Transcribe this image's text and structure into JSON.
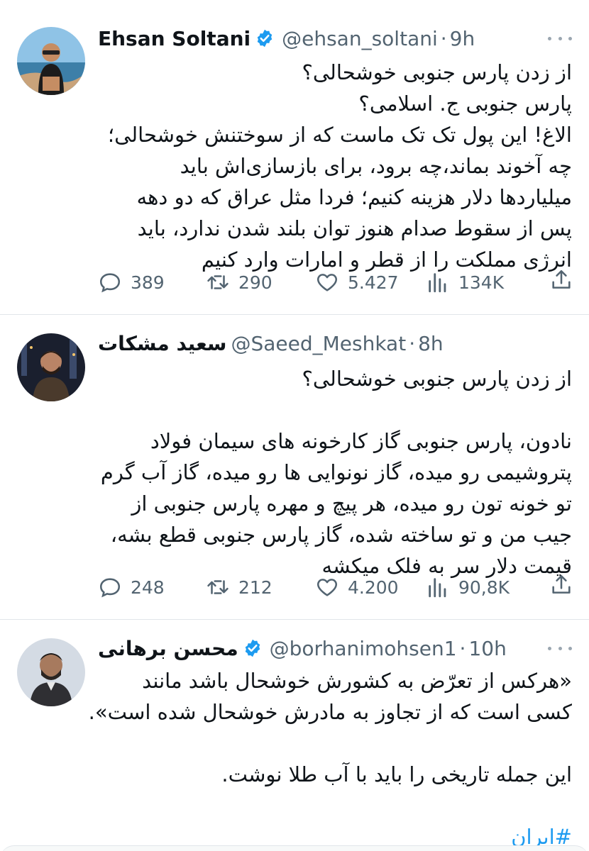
{
  "tweets": [
    {
      "name": "Ehsan Soltani",
      "verified": true,
      "handle": "@ehsan_soltani",
      "sep": "·",
      "time": "9h",
      "lines": [
        "از زدن پارس جنوبی خوشحالی؟",
        "پارس جنوبی ج. اسلامی؟",
        "الاغ! این پول تک تک ماست که از سوختنش خوشحالی؛",
        "چه آخوند بماند،چه برود، برای بازسازی‌اش باید",
        "میلیاردها دلار هزینه کنیم؛ فردا مثل عراق که دو دهه",
        "پس از سقوط صدام هنوز توان بلند شدن ندارد، باید",
        "انرژی مملکت را از قطر و امارات وارد کنیم"
      ],
      "stats": {
        "replies": "389",
        "retweets": "290",
        "likes": "5.427",
        "views": "134K"
      }
    },
    {
      "name": "سعید مشکات",
      "verified": false,
      "handle": "@Saeed_Meshkat",
      "sep": "·",
      "time": "8h",
      "lines": [
        "از زدن پارس جنوبی خوشحالی؟",
        "",
        "نادون، پارس جنوبی گاز کارخونه های سیمان فولاد",
        "پتروشیمی رو میده، گاز نونوایی ها رو میده، گاز آب گرم",
        "تو خونه تون رو میده، هر پیچ و مهره پارس جنوبی از",
        "جیب من و تو ساخته شده، گاز پارس جنوبی قطع بشه،",
        "قیمت دلار سر به فلک میکشه"
      ],
      "stats": {
        "replies": "248",
        "retweets": "212",
        "likes": "4.200",
        "views": "90,8K"
      }
    },
    {
      "name": "محسن برهانی",
      "verified": true,
      "handle": "@borhanimohsen1",
      "sep": "·",
      "time": "10h",
      "lines": [
        "«هرکس از تعرّض به کشورش خوشحال باشد مانند",
        "کسی است که از تجاوز به مادرش خوشحال شده است».",
        "",
        "این جمله تاریخی را باید با آب طلا نوشت.",
        "",
        "#ایران"
      ]
    }
  ],
  "colors": {
    "text": "#0f1419",
    "secondary": "#536471",
    "accent": "#1d9bf0",
    "divider": "#e1e6ea"
  },
  "icons": [
    "reply-icon",
    "retweet-icon",
    "like-icon",
    "views-icon",
    "share-icon",
    "verified-icon",
    "more-icon"
  ]
}
